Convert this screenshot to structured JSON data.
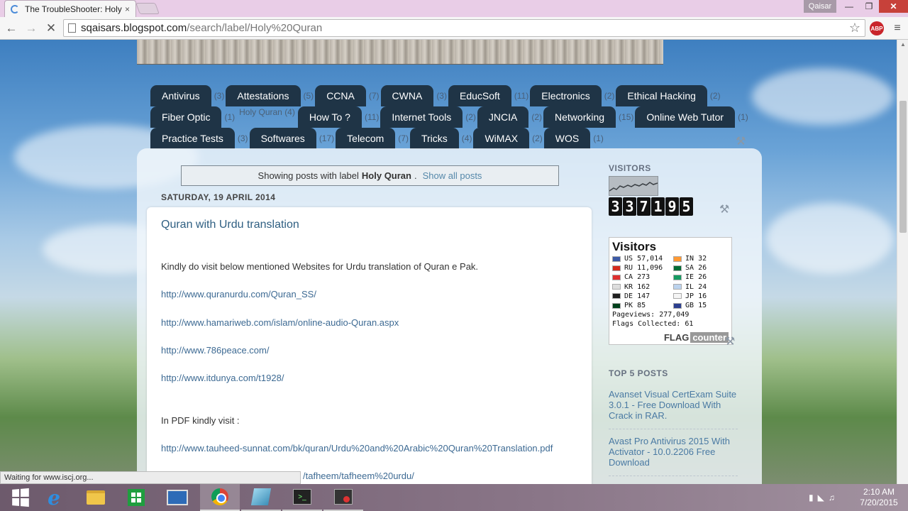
{
  "browser": {
    "tab_title": "The TroubleShooter: Holy",
    "tab_close": "×",
    "user_name": "Qaisar",
    "url_host": "sqaisars.blogspot.com",
    "url_path": "/search/label/Holy%20Quran",
    "abp_label": "ABP",
    "status_text": "Waiting for www.iscj.org..."
  },
  "labels": {
    "row1": [
      {
        "name": "Antivirus",
        "count": "(3)"
      },
      {
        "name": "Attestations",
        "count": "(5)"
      },
      {
        "name": "CCNA",
        "count": "(7)"
      },
      {
        "name": "CWNA",
        "count": "(3)"
      },
      {
        "name": "EducSoft",
        "count": "(11)"
      },
      {
        "name": "Electronics",
        "count": "(2)"
      },
      {
        "name": "Ethical Hacking",
        "count": "(2)"
      }
    ],
    "row2": [
      {
        "name": "Fiber Optic",
        "count": "(1)"
      },
      {
        "name": "Holy Quran",
        "count": "(4)"
      },
      {
        "name": "How To ?",
        "count": "(11)"
      },
      {
        "name": "Internet Tools",
        "count": "(2)"
      },
      {
        "name": "JNCIA",
        "count": "(2)"
      },
      {
        "name": "Networking",
        "count": "(15)"
      },
      {
        "name": "Online Web Tutor",
        "count": "(1)"
      }
    ],
    "row3": [
      {
        "name": "Practice Tests",
        "count": "(3)"
      },
      {
        "name": "Softwares",
        "count": "(17)"
      },
      {
        "name": "Telecom",
        "count": "(7)"
      },
      {
        "name": "Tricks",
        "count": "(4)"
      },
      {
        "name": "WiMAX",
        "count": "(2)"
      },
      {
        "name": "WOS",
        "count": "(1)"
      }
    ]
  },
  "notice": {
    "prefix": "Showing posts with label",
    "label": "Holy Quran",
    "suffix": ".",
    "show_all": "Show all posts"
  },
  "post": {
    "date": "SATURDAY, 19 APRIL 2014",
    "title": "Quran with Urdu translation",
    "intro": "Kindly do visit below mentioned Websites for Urdu translation of Quran e Pak.",
    "links": [
      "http://www.quranurdu.com/Quran_SS/",
      "http://www.hamariweb.com/islam/online-audio-Quran.aspx",
      "http://www.786peace.com/",
      "http://www.itdunya.com/t1928/"
    ],
    "pdf_text": "In PDF kindly visit :",
    "pdf_link": "http://www.tauheed-sunnat.com/bk/quran/Urdu%20and%20Arabic%20Quran%20Translation.pdf",
    "partial_link": "/tafheem/tafheem%20urdu/"
  },
  "sidebar": {
    "visitors_heading": "VISITORS",
    "counter_digits": [
      "3",
      "3",
      "7",
      "1",
      "9",
      "5"
    ],
    "flag_counter": {
      "title": "Visitors",
      "left": [
        {
          "code": "US",
          "count": "57,014",
          "color": "#3c5aa6"
        },
        {
          "code": "RU",
          "count": "11,096",
          "color": "#d52b1e"
        },
        {
          "code": "CA",
          "count": "273",
          "color": "#e03030"
        },
        {
          "code": "KR",
          "count": "162",
          "color": "#dddddd"
        },
        {
          "code": "DE",
          "count": "147",
          "color": "#202020"
        },
        {
          "code": "PK",
          "count": "85",
          "color": "#01411c"
        }
      ],
      "right": [
        {
          "code": "IN",
          "count": "32",
          "color": "#ff9933"
        },
        {
          "code": "SA",
          "count": "26",
          "color": "#006c35"
        },
        {
          "code": "IE",
          "count": "26",
          "color": "#169b62"
        },
        {
          "code": "IL",
          "count": "24",
          "color": "#bcd3ee"
        },
        {
          "code": "JP",
          "count": "16",
          "color": "#f5f5f5"
        },
        {
          "code": "GB",
          "count": "15",
          "color": "#2c3f8f"
        }
      ],
      "pageviews": "Pageviews: 277,049",
      "flags_collected": "Flags Collected: 61",
      "logo_flag": "FLAG",
      "logo_counter": "counter"
    },
    "top_posts_heading": "TOP 5 POSTS",
    "top_posts": [
      "Avanset Visual CertExam Suite 3.0.1 - Free Download With Crack in RAR.",
      "Avast Pro Antivirus 2015 With Activator - 10.0.2206 Free Download"
    ]
  },
  "taskbar": {
    "time": "2:10 AM",
    "date": "7/20/2015"
  }
}
